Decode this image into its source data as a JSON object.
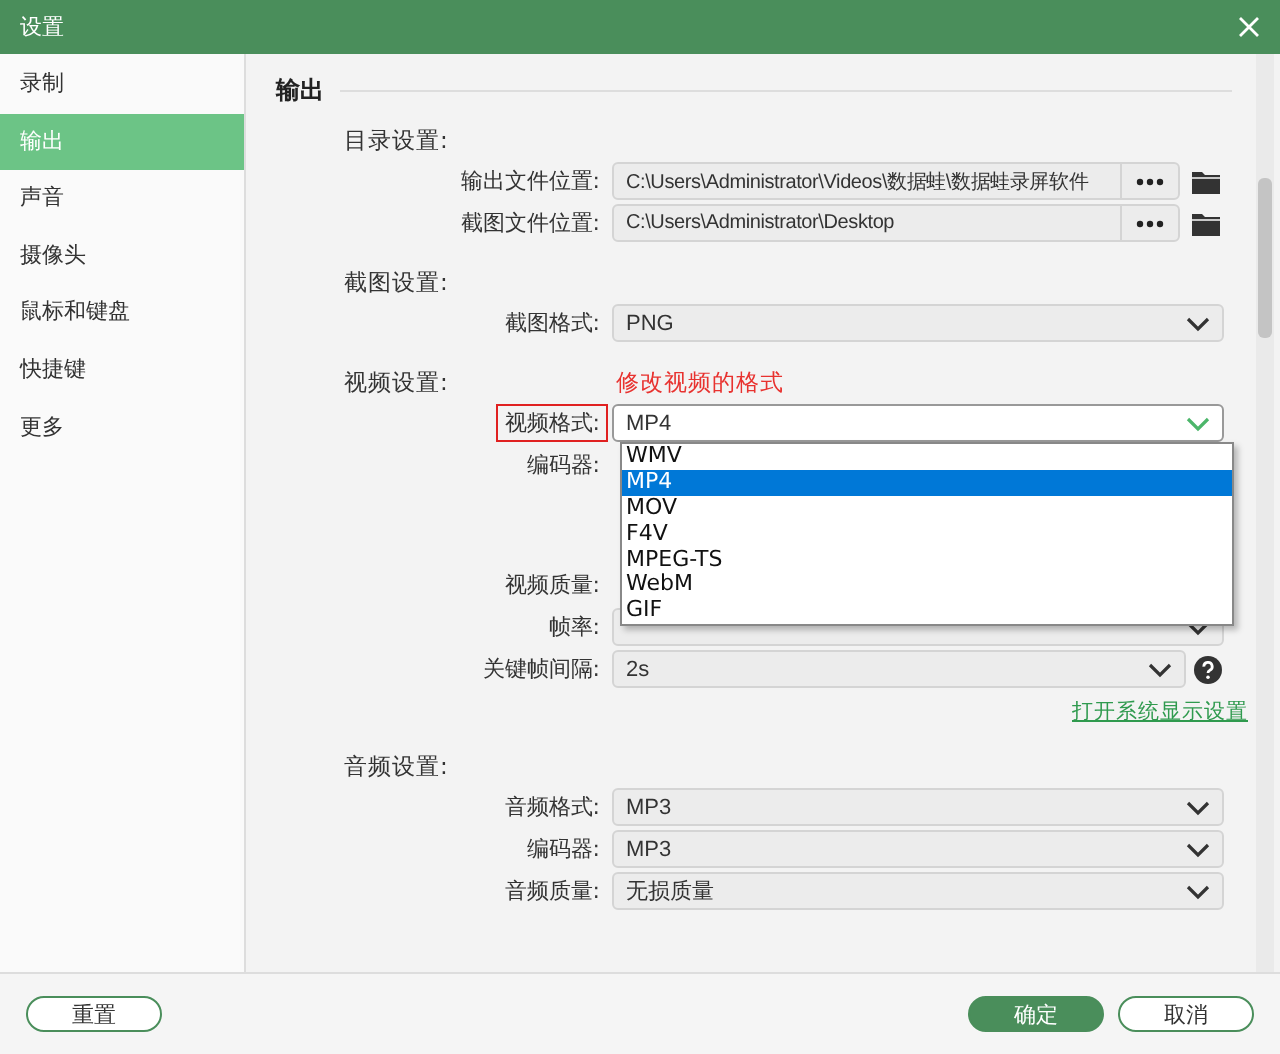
{
  "window": {
    "title": "设置"
  },
  "sidebar": {
    "items": [
      {
        "label": "录制",
        "selected": false
      },
      {
        "label": "输出",
        "selected": true
      },
      {
        "label": "声音",
        "selected": false
      },
      {
        "label": "摄像头",
        "selected": false
      },
      {
        "label": "鼠标和键盘",
        "selected": false
      },
      {
        "label": "快捷键",
        "selected": false
      },
      {
        "label": "更多",
        "selected": false
      }
    ]
  },
  "content": {
    "heading": "输出",
    "sections": [
      {
        "title": "目录设置:",
        "rows": [
          {
            "kind": "path",
            "label": "输出文件位置:",
            "value": "C:\\Users\\Administrator\\Videos\\数据蛙\\数据蛙录屏软件"
          },
          {
            "kind": "path",
            "label": "截图文件位置:",
            "value": "C:\\Users\\Administrator\\Desktop"
          }
        ]
      },
      {
        "title": "截图设置:",
        "rows": [
          {
            "kind": "select",
            "label": "截图格式:",
            "value": "PNG"
          }
        ]
      },
      {
        "title": "视频设置:",
        "annotation": "修改视频的格式",
        "rows": [
          {
            "kind": "select",
            "label": "视频格式:",
            "value": "MP4",
            "highlighted": true,
            "open": true,
            "options": [
              {
                "label": "WMV",
                "selected": false
              },
              {
                "label": "MP4",
                "selected": true
              },
              {
                "label": "MOV",
                "selected": false
              },
              {
                "label": "F4V",
                "selected": false
              },
              {
                "label": "MPEG-TS",
                "selected": false
              },
              {
                "label": "WebM",
                "selected": false
              },
              {
                "label": "GIF",
                "selected": false
              }
            ]
          },
          {
            "kind": "covered",
            "label": "编码器:"
          },
          {
            "kind": "covered",
            "label": "视频质量:"
          },
          {
            "kind": "select",
            "label": "帧率:"
          },
          {
            "kind": "help",
            "label": "关键帧间隔:",
            "value": "2s"
          }
        ],
        "link": "打开系统显示设置"
      },
      {
        "title": "音频设置:",
        "rows": [
          {
            "kind": "select",
            "label": "音频格式:",
            "value": "MP3"
          },
          {
            "kind": "select",
            "label": "编码器:",
            "value": "MP3"
          },
          {
            "kind": "select",
            "label": "音频质量:",
            "value": "无损质量"
          }
        ]
      }
    ]
  },
  "footer": {
    "reset": "重置",
    "ok": "确定",
    "cancel": "取消"
  }
}
